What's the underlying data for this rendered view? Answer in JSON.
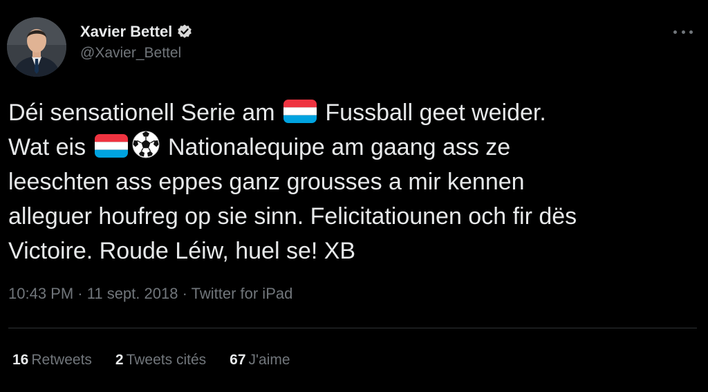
{
  "tweet": {
    "author": {
      "display_name": "Xavier Bettel",
      "handle": "@Xavier_Bettel",
      "verified": true
    },
    "text_lines": [
      [
        "Déi sensationell Serie am ",
        "",
        " Fussball  geet weider."
      ],
      [
        "Wat eis ",
        "",
        " Nationalequipe am gaang ass ze"
      ],
      [
        "leeschten ass eppes ganz grousses a mir kennen"
      ],
      [
        "alleguer houfreg op sie sinn. Felicitatiounen och fir dës"
      ],
      [
        "Victoire. Roude Léiw, huel se! XB"
      ]
    ],
    "emojis": {
      "line1": [
        "flag-luxembourg-icon"
      ],
      "line2": [
        "flag-luxembourg-icon",
        "soccer-ball-icon"
      ]
    },
    "meta": {
      "time": "10:43 PM",
      "separator": "·",
      "date": "11 sept. 2018",
      "source": "Twitter for iPad"
    },
    "stats": {
      "retweets_count": "16",
      "retweets_label": "Retweets",
      "quotes_count": "2",
      "quotes_label": "Tweets cités",
      "likes_count": "67",
      "likes_label": "J'aime"
    }
  },
  "colors": {
    "background": "#000000",
    "text_primary": "#e7e9ea",
    "text_secondary": "#71767b",
    "divider": "#2f3336",
    "lux_red": "#ef3340",
    "lux_blue": "#00a3e0"
  }
}
